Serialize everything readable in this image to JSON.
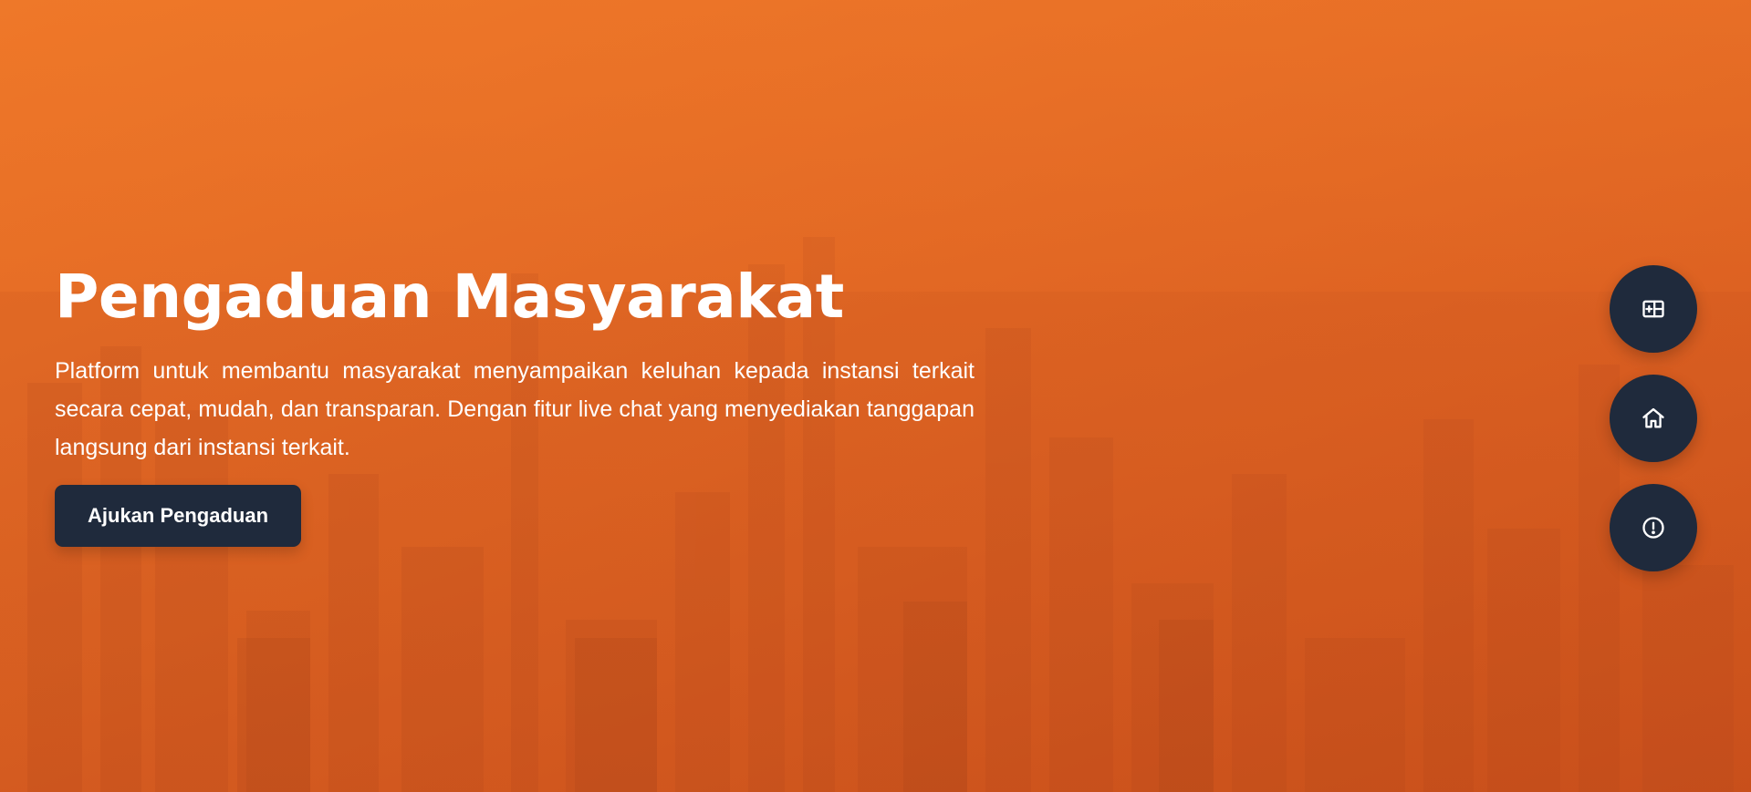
{
  "hero": {
    "title": "Pengaduan Masyarakat",
    "description": "Platform untuk membantu masyarakat menyampaikan keluhan kepada instansi terkait secara cepat, mudah, dan transparan. Dengan fitur live chat yang menyediakan tanggapan langsung dari instansi terkait.",
    "cta_label": "Ajukan Pengaduan"
  },
  "floating_actions": [
    {
      "icon": "add-card-icon"
    },
    {
      "icon": "home-icon"
    },
    {
      "icon": "alert-circle-icon"
    }
  ],
  "colors": {
    "background_orange": "#e36a25",
    "button_navy": "#1f2a3c",
    "text_white": "#ffffff"
  }
}
